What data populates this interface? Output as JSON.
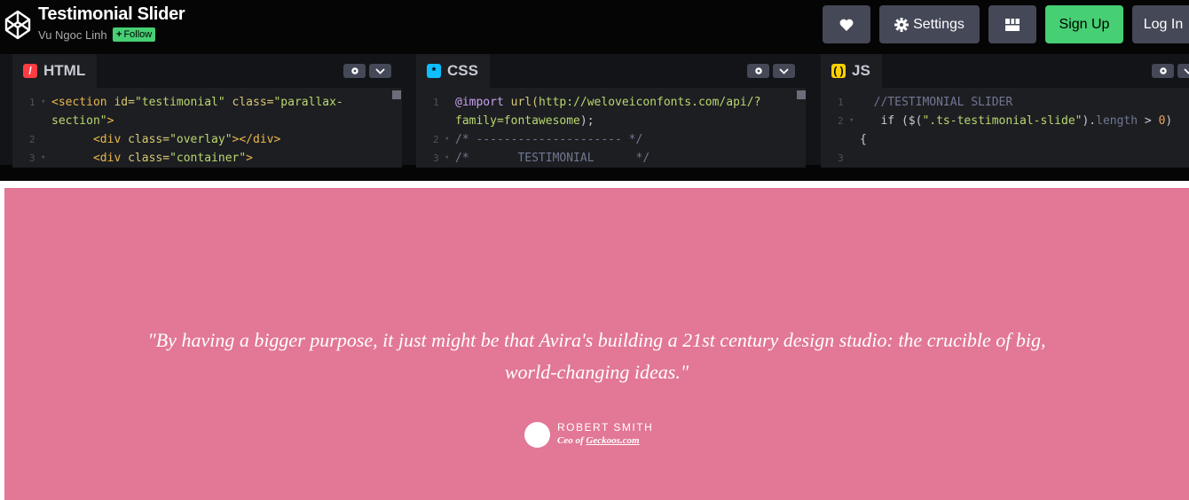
{
  "header": {
    "title": "Testimonial Slider",
    "author": "Vu Ngoc Linh",
    "follow_label": "Follow",
    "settings_label": "Settings",
    "signup_label": "Sign Up",
    "login_label": "Log In"
  },
  "editors": {
    "html": {
      "label": "HTML",
      "lines": [
        {
          "n": "1",
          "fold": true
        },
        {
          "n": "",
          "fold": false
        },
        {
          "n": "2",
          "fold": false
        },
        {
          "n": "3",
          "fold": true
        }
      ]
    },
    "css": {
      "label": "CSS",
      "lines": [
        {
          "n": "1",
          "fold": false
        },
        {
          "n": "",
          "fold": false
        },
        {
          "n": "2",
          "fold": true
        },
        {
          "n": "3",
          "fold": true
        }
      ]
    },
    "js": {
      "label": "JS",
      "lines": [
        {
          "n": "1",
          "fold": false
        },
        {
          "n": "2",
          "fold": true
        },
        {
          "n": "",
          "fold": false
        },
        {
          "n": "3",
          "fold": false
        }
      ]
    }
  },
  "code": {
    "html_1a": "<section",
    "html_1b": " id=",
    "html_1c": "\"testimonial\"",
    "html_1d": " class=",
    "html_1e": "\"parallax-",
    "html_2a": "section\"",
    "html_2b": ">",
    "html_3a": "      <div",
    "html_3b": " class=",
    "html_3c": "\"overlay\"",
    "html_3d": "></div>",
    "html_4a": "      <div",
    "html_4b": " class=",
    "html_4c": "\"container\"",
    "html_4d": ">",
    "css_1a": "@import",
    "css_1b": " url(",
    "css_1c": "http://weloveiconfonts.com/api/?",
    "css_2a": "family=fontawesome",
    "css_2b": ");",
    "css_3": "/* --------------------- */",
    "css_4": "/*       TESTIMONIAL      */",
    "js_1": "  //TESTIMONIAL SLIDER",
    "js_2a": "   if ($(",
    "js_2b": "\".ts-testimonial-slide\"",
    "js_2c": ").",
    "js_2d": "length",
    "js_2e": " > ",
    "js_2f": "0",
    "js_2g": ")",
    "js_3": "{"
  },
  "preview": {
    "quote_line1": "\"By having a bigger purpose, it just might be that Avira's building a 21st century design studio: the crucible of big,",
    "quote_line2": "world-changing ideas.\"",
    "person_name": "ROBERT SMITH",
    "role_prefix": "Ceo of ",
    "role_link": "Geckoos.com"
  },
  "colors": {
    "preview_bg": "#e27796",
    "signup_bg": "#47cf73",
    "button_bg": "#444857"
  },
  "icons": [
    "codepen-logo-icon",
    "heart-icon",
    "gear-icon",
    "layout-icon",
    "chevron-down-icon"
  ]
}
